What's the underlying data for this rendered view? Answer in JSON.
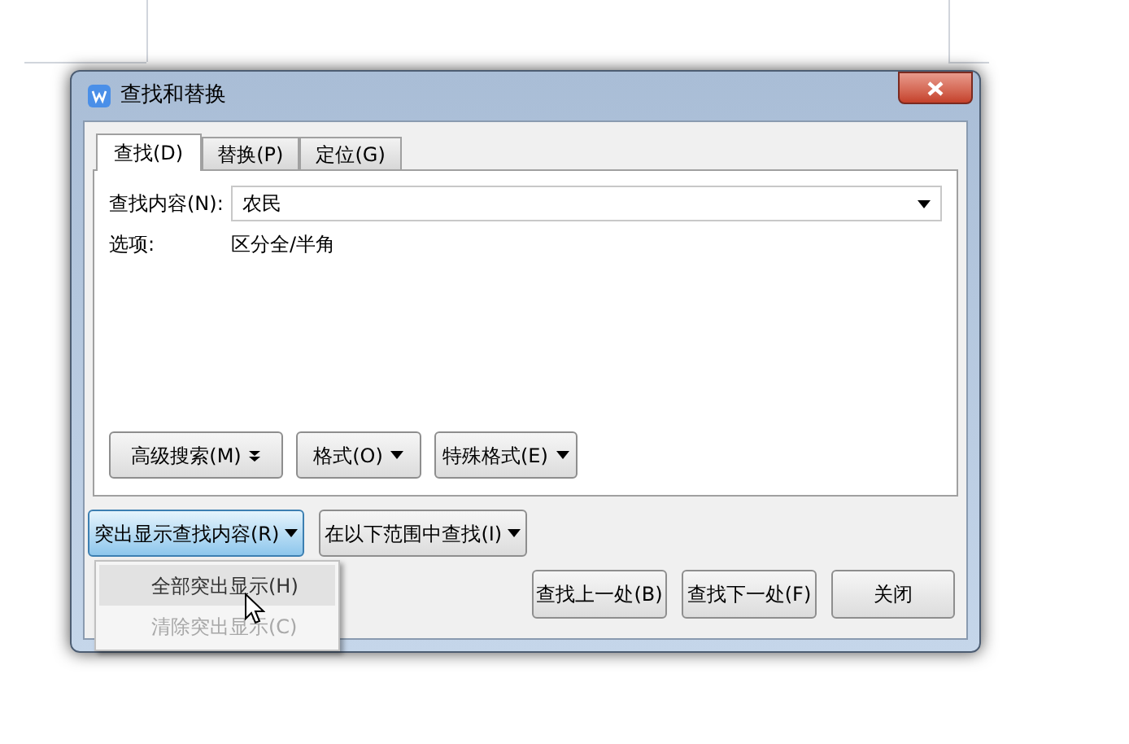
{
  "window": {
    "title": "查找和替换"
  },
  "tabs": [
    {
      "label": "查找(D)",
      "selected": true
    },
    {
      "label": "替换(P)",
      "selected": false
    },
    {
      "label": "定位(G)",
      "selected": false
    }
  ],
  "find_field": {
    "label": "查找内容(N):",
    "value": "农民"
  },
  "options": {
    "label": "选项:",
    "value": "区分全/半角"
  },
  "panel_buttons": [
    {
      "label": "高级搜索(M)",
      "kind": "double"
    },
    {
      "label": "格式(O)",
      "kind": "single"
    },
    {
      "label": "特殊格式(E)",
      "kind": "single"
    }
  ],
  "menu_buttons": [
    {
      "label": "突出显示查找内容(R)",
      "selected": true
    },
    {
      "label": "在以下范围中查找(I)",
      "selected": false
    }
  ],
  "menu": [
    {
      "label": "全部突出显示(H)",
      "disabled": false,
      "selected": true
    },
    {
      "label": "清除突出显示(C)",
      "disabled": true,
      "selected": false
    }
  ],
  "buttons": [
    "查找上一处(B)",
    "查找下一处(F)",
    "关闭"
  ]
}
